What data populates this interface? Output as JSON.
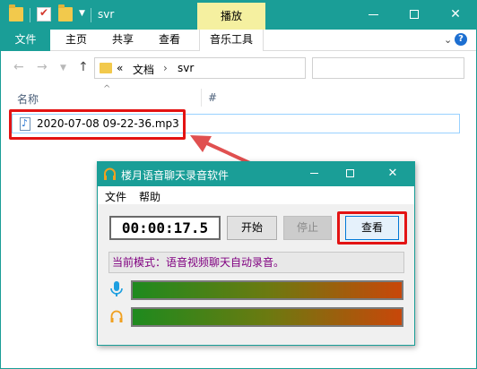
{
  "explorer": {
    "title": "svr",
    "context_tab": "播放",
    "ribbon_tabs": [
      "文件",
      "主页",
      "共享",
      "查看",
      "音乐工具"
    ],
    "address": {
      "prefix": "«",
      "crumbs": [
        "文档",
        "svr"
      ]
    },
    "columns": {
      "name": "名称",
      "number": "#"
    },
    "file": {
      "name": "2020-07-08 09-22-36.mp3"
    }
  },
  "recorder": {
    "title": "楼月语音聊天录音软件",
    "menu": [
      "文件",
      "帮助"
    ],
    "timer": "00:00:17.5",
    "buttons": {
      "start": "开始",
      "stop": "停止",
      "view": "查看"
    },
    "status": "当前模式：语音视频聊天自动录音。"
  },
  "colors": {
    "titlebar": "#1a9e97",
    "highlight_box": "#e31313",
    "status_text": "#800080",
    "context_tab": "#f5f0a0"
  }
}
